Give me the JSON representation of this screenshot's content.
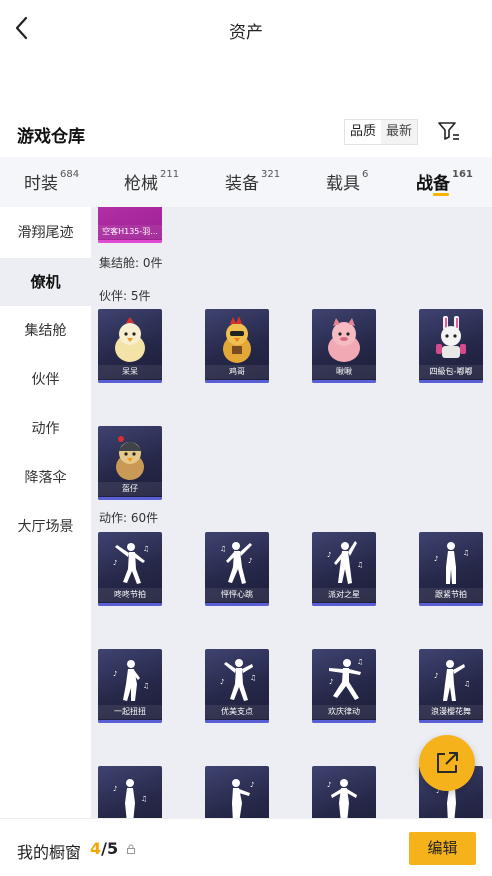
{
  "header": {
    "title": "资产"
  },
  "warehouse": {
    "title": "游戏仓库",
    "sort_quality": "品质",
    "sort_newest": "最新"
  },
  "tabs": [
    {
      "label": "时装",
      "count": "684"
    },
    {
      "label": "枪械",
      "count": "211"
    },
    {
      "label": "装备",
      "count": "321"
    },
    {
      "label": "载具",
      "count": "6"
    },
    {
      "label": "战备",
      "count": "161"
    }
  ],
  "sidebar": [
    {
      "label": "滑翔尾迹"
    },
    {
      "label": "僚机"
    },
    {
      "label": "集结舱"
    },
    {
      "label": "伙伴"
    },
    {
      "label": "动作"
    },
    {
      "label": "降落伞"
    },
    {
      "label": "大厅场景"
    }
  ],
  "content": {
    "top_item": {
      "label": "空客H135-羽..."
    },
    "pod_group": {
      "title": "集结舱: 0件"
    },
    "partner_group": {
      "title": "伙伴: 5件",
      "items": [
        {
          "label": "呆呆",
          "icon": "chick-figure"
        },
        {
          "label": "鸡哥",
          "icon": "rooster-figure"
        },
        {
          "label": "啾啾",
          "icon": "pink-creature-figure"
        },
        {
          "label": "四級包-嘟嘟",
          "icon": "rabbit-mecha-figure"
        },
        {
          "label": "盔仔",
          "icon": "helmet-bird-figure"
        }
      ]
    },
    "emote_group": {
      "title": "动作: 60件",
      "items": [
        {
          "label": "咚咚节拍"
        },
        {
          "label": "怦怦心跳"
        },
        {
          "label": "派对之星"
        },
        {
          "label": "跟紧节拍"
        },
        {
          "label": "一起扭扭"
        },
        {
          "label": "优美支点"
        },
        {
          "label": "欢庆律动"
        },
        {
          "label": "浪漫樱花舞"
        },
        {
          "label": ""
        },
        {
          "label": ""
        },
        {
          "label": ""
        },
        {
          "label": ""
        }
      ]
    }
  },
  "bottom": {
    "showcase_label": "我的橱窗",
    "showcase_current": "4",
    "showcase_total": "/5",
    "edit_label": "编辑"
  },
  "colors": {
    "accent": "#f6b21a",
    "card_dark": "#262849",
    "card_pink": "#b12aa5",
    "content_bg": "#eceef3"
  }
}
